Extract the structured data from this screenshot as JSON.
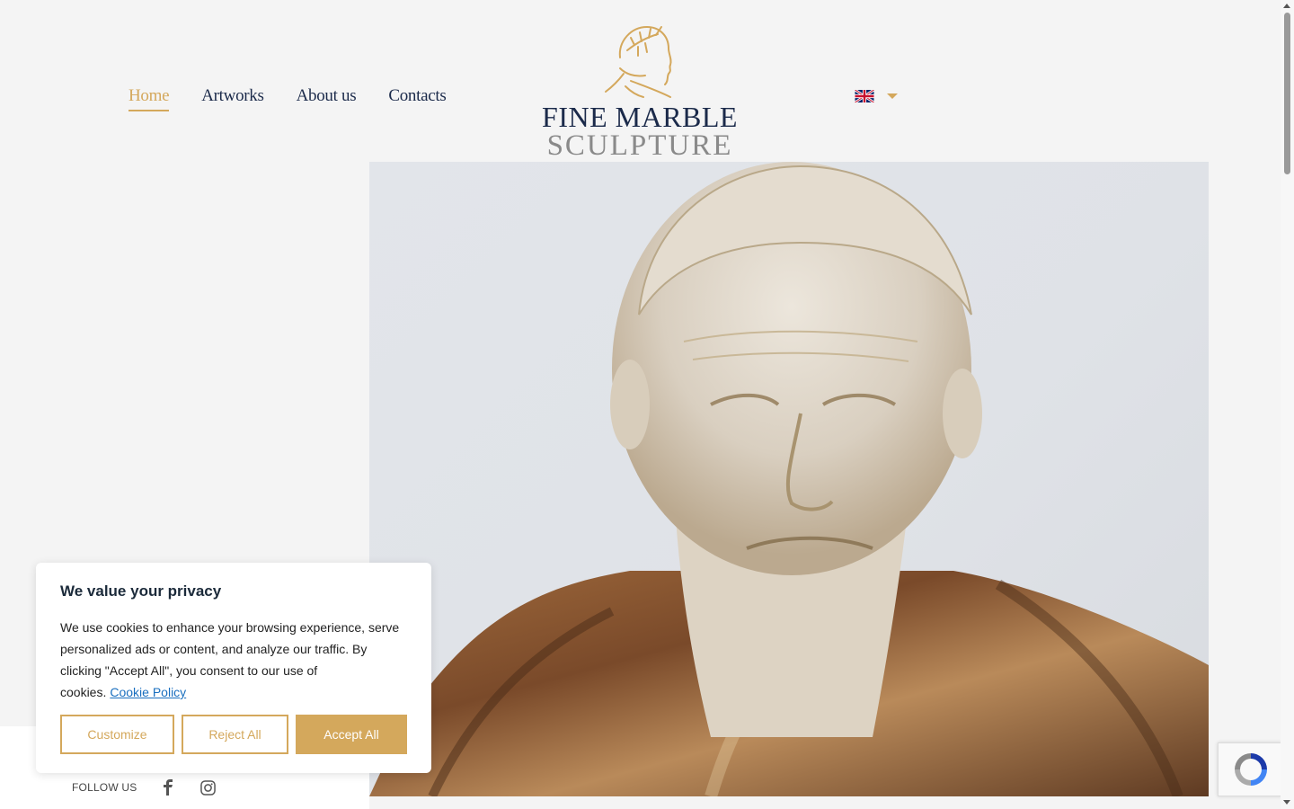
{
  "nav": {
    "items": [
      {
        "label": "Home",
        "active": true
      },
      {
        "label": "Artworks",
        "active": false
      },
      {
        "label": "About us",
        "active": false
      },
      {
        "label": "Contacts",
        "active": false
      }
    ]
  },
  "logo": {
    "line1": "FINE MARBLE",
    "line2": "SCULPTURE",
    "icon": "laurel-head-logo-icon"
  },
  "language": {
    "selected_flag": "uk-flag-icon",
    "dropdown_icon": "caret-down-icon"
  },
  "hero": {
    "image": "marble-bust-image"
  },
  "footer": {
    "follow_label": "FOLLOW US",
    "socials": [
      "facebook-icon",
      "instagram-icon"
    ]
  },
  "cookie_banner": {
    "title": "We value your privacy",
    "body": "We use cookies to enhance your browsing experience, serve personalized ads or content, and analyze our traffic. By clicking \"Accept All\", you consent to our use of cookies.",
    "policy_link": "Cookie Policy",
    "buttons": {
      "customize": "Customize",
      "reject": "Reject All",
      "accept": "Accept All"
    }
  },
  "colors": {
    "accent": "#d4a85c",
    "navy": "#1b2a4a",
    "background": "#f4f4f4"
  }
}
